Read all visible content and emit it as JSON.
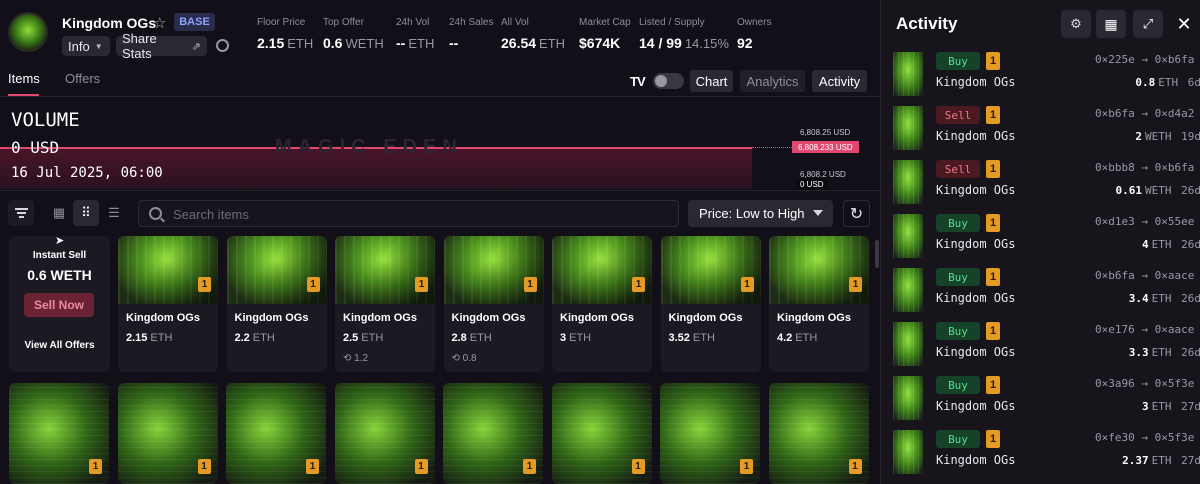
{
  "collection": {
    "name": "Kingdom OGs",
    "chain_badge": "BASE",
    "info_label": "Info",
    "share_label": "Share Stats"
  },
  "stats": [
    {
      "label": "Floor Price",
      "value": "2.15",
      "unit": "ETH"
    },
    {
      "label": "Top Offer",
      "value": "0.6",
      "unit": "WETH"
    },
    {
      "label": "24h Vol",
      "value": "--",
      "unit": "ETH"
    },
    {
      "label": "24h Sales",
      "value": "--",
      "unit": ""
    },
    {
      "label": "All Vol",
      "value": "26.54",
      "unit": "ETH"
    },
    {
      "label": "Market Cap",
      "value": "$674K",
      "unit": ""
    },
    {
      "label": "Listed / Supply",
      "value": "14 / 99",
      "unit": "14.15%"
    },
    {
      "label": "Owners",
      "value": "92",
      "unit": ""
    }
  ],
  "tabs": [
    {
      "label": "Items",
      "active": true
    },
    {
      "label": "Offers",
      "active": false
    }
  ],
  "view_buttons": {
    "tv_logo": "TV",
    "chart": "Chart",
    "analytics": "Analytics",
    "activity": "Activity"
  },
  "chart": {
    "title": "VOLUME",
    "value": "0 USD",
    "date": "16 Jul 2025, 06:00",
    "watermark": "MAGIC EDEN",
    "axis": {
      "top": "6,808.25 USD",
      "marker": "6,808.233 USD",
      "low": "6,808.2 USD",
      "zero": "0 USD"
    }
  },
  "toolbar": {
    "search_placeholder": "Search items",
    "sort_label": "Price: Low to High"
  },
  "instant_sell": {
    "title": "Instant Sell",
    "price": "0.6 WETH",
    "button": "Sell Now",
    "link": "View All Offers"
  },
  "items_row1": [
    {
      "name": "Kingdom OGs",
      "price": "2.15",
      "unit": "ETH",
      "qty": "1",
      "last": ""
    },
    {
      "name": "Kingdom OGs",
      "price": "2.2",
      "unit": "ETH",
      "qty": "1",
      "last": ""
    },
    {
      "name": "Kingdom OGs",
      "price": "2.5",
      "unit": "ETH",
      "qty": "1",
      "last": "1.2"
    },
    {
      "name": "Kingdom OGs",
      "price": "2.8",
      "unit": "ETH",
      "qty": "1",
      "last": "0.8"
    },
    {
      "name": "Kingdom OGs",
      "price": "3",
      "unit": "ETH",
      "qty": "1",
      "last": ""
    },
    {
      "name": "Kingdom OGs",
      "price": "3.52",
      "unit": "ETH",
      "qty": "1",
      "last": ""
    },
    {
      "name": "Kingdom OGs",
      "price": "4.2",
      "unit": "ETH",
      "qty": "1",
      "last": ""
    }
  ],
  "items_row2": [
    {
      "qty": "1"
    },
    {
      "qty": "1"
    },
    {
      "qty": "1"
    },
    {
      "qty": "1"
    },
    {
      "qty": "1"
    },
    {
      "qty": "1"
    },
    {
      "qty": "1"
    },
    {
      "qty": "1"
    }
  ],
  "activity": {
    "title": "Activity",
    "rows": [
      {
        "type": "Buy",
        "qty": "1",
        "name": "Kingdom OGs",
        "from": "0×225e",
        "to": "0×b6fa",
        "price": "0.8",
        "unit": "ETH",
        "age": "6d"
      },
      {
        "type": "Sell",
        "qty": "1",
        "name": "Kingdom OGs",
        "from": "0×b6fa",
        "to": "0×d4a2",
        "price": "2",
        "unit": "WETH",
        "age": "19d"
      },
      {
        "type": "Sell",
        "qty": "1",
        "name": "Kingdom OGs",
        "from": "0×bbb8",
        "to": "0×b6fa",
        "price": "0.61",
        "unit": "WETH",
        "age": "26d"
      },
      {
        "type": "Buy",
        "qty": "1",
        "name": "Kingdom OGs",
        "from": "0×d1e3",
        "to": "0×55ee",
        "price": "4",
        "unit": "ETH",
        "age": "26d"
      },
      {
        "type": "Buy",
        "qty": "1",
        "name": "Kingdom OGs",
        "from": "0×b6fa",
        "to": "0×aace",
        "price": "3.4",
        "unit": "ETH",
        "age": "26d"
      },
      {
        "type": "Buy",
        "qty": "1",
        "name": "Kingdom OGs",
        "from": "0×e176",
        "to": "0×aace",
        "price": "3.3",
        "unit": "ETH",
        "age": "26d"
      },
      {
        "type": "Buy",
        "qty": "1",
        "name": "Kingdom OGs",
        "from": "0×3a96",
        "to": "0×5f3e",
        "price": "3",
        "unit": "ETH",
        "age": "27d"
      },
      {
        "type": "Buy",
        "qty": "1",
        "name": "Kingdom OGs",
        "from": "0×fe30",
        "to": "0×5f3e",
        "price": "2.37",
        "unit": "ETH",
        "age": "27d"
      }
    ]
  },
  "colors": {
    "accent": "#e0486f",
    "buy": "#4ee08a",
    "sell": "#f0798a",
    "badge": "#e39b26"
  }
}
